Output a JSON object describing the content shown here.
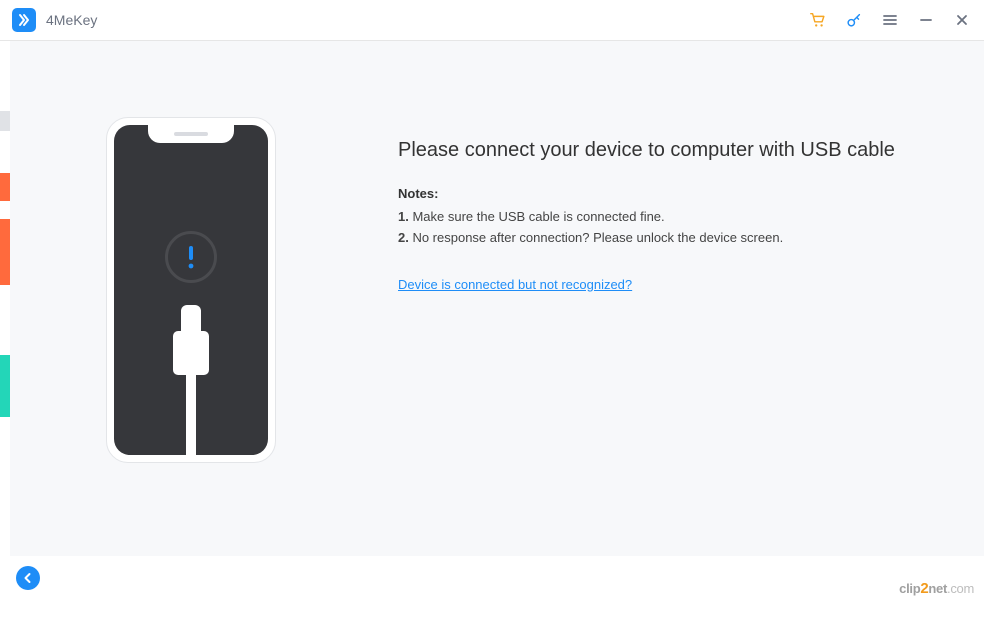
{
  "app": {
    "title": "4MeKey"
  },
  "titlebar_icons": {
    "cart": "cart-icon",
    "key": "key-icon",
    "menu": "menu-icon",
    "minimize": "minimize-icon",
    "close": "close-icon"
  },
  "main": {
    "heading": "Please connect your device to computer with USB cable",
    "notes_label": "Notes:",
    "notes": [
      {
        "num": "1.",
        "text": " Make sure the USB cable is connected fine."
      },
      {
        "num": "2.",
        "text": " No response after connection? Please unlock the device screen."
      }
    ],
    "help_link": "Device is connected but not recognized?"
  },
  "watermark": {
    "pre": "clip",
    "accent": "2",
    "post": "net",
    "tld": ".com"
  }
}
